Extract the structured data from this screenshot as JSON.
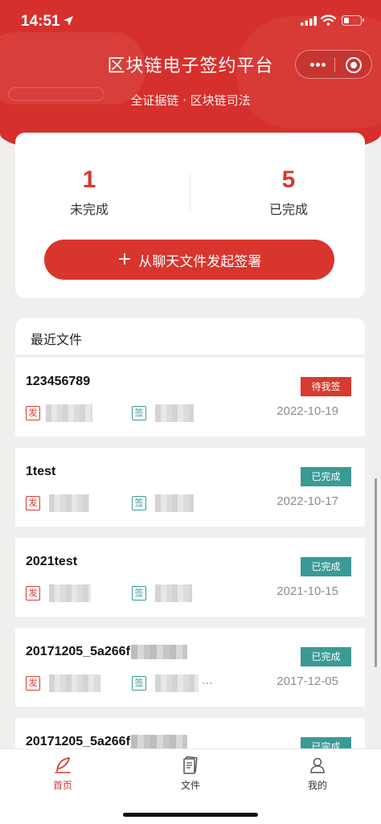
{
  "status_bar": {
    "time": "14:51"
  },
  "header": {
    "title": "区块链电子签约平台",
    "subtitle": "全证据链 · 区块链司法"
  },
  "stats": {
    "incomplete": {
      "value": "1",
      "label": "未完成"
    },
    "complete": {
      "value": "5",
      "label": "已完成"
    }
  },
  "sign_button": {
    "icon": "plus-icon",
    "label": "从聊天文件发起签署"
  },
  "recent": {
    "title": "最近文件",
    "send_tag": "发",
    "sign_tag": "签",
    "items": [
      {
        "title": "123456789",
        "status": "待我签",
        "date": "2022-10-19",
        "sign_trail": ""
      },
      {
        "title": "1test",
        "status": "已完成",
        "date": "2022-10-17",
        "sign_trail": ""
      },
      {
        "title": "2021test",
        "status": "已完成",
        "date": "2021-10-15",
        "sign_trail": ""
      },
      {
        "title": "20171205_5a266f",
        "status": "已完成",
        "date": "2017-12-05",
        "sign_trail": "..."
      },
      {
        "title": "20171205_5a266f",
        "status": "已完成",
        "date": "",
        "sign_trail": ""
      }
    ]
  },
  "colors": {
    "brand_red": "#d6302c",
    "done_teal": "#3a9a96"
  },
  "tabbar": {
    "items": [
      {
        "icon": "quill-icon",
        "label": "首页"
      },
      {
        "icon": "document-icon",
        "label": "文件"
      },
      {
        "icon": "user-icon",
        "label": "我的"
      }
    ]
  }
}
